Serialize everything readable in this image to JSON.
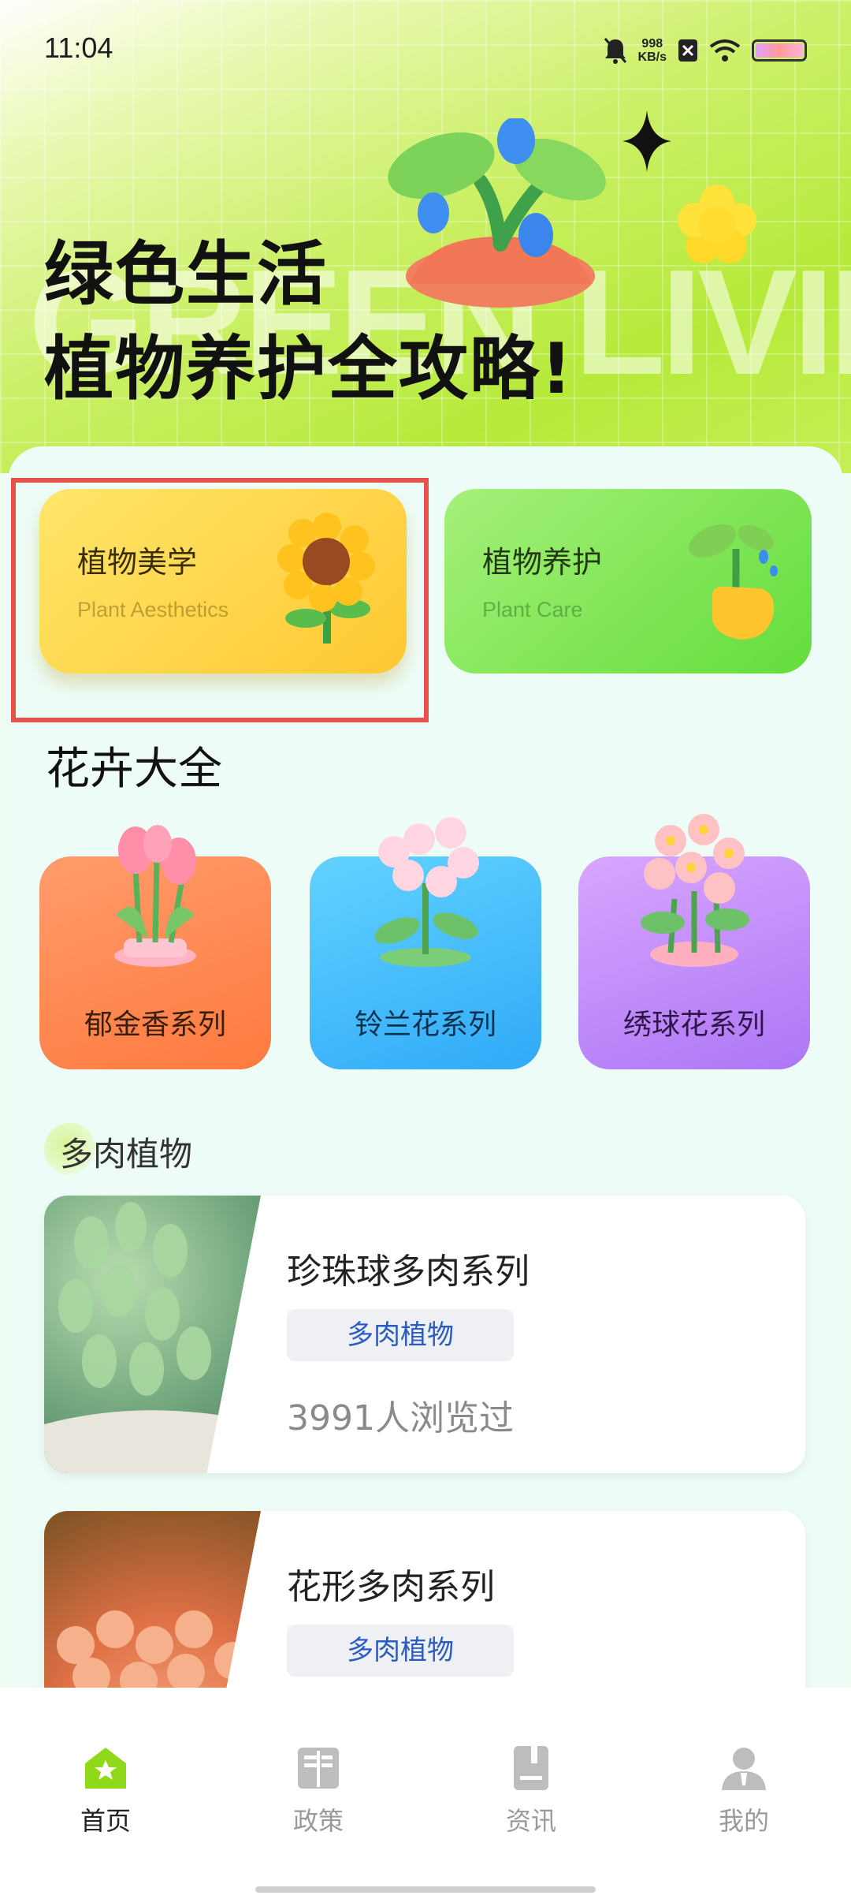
{
  "status_bar": {
    "time": "11:04",
    "net_speed_value": "998",
    "net_speed_unit": "KB/s",
    "icons": [
      "bell-muted-icon",
      "sim-x-icon",
      "wifi-icon",
      "battery-icon"
    ]
  },
  "hero": {
    "title_line1": "绿色生活",
    "title_line2": "植物养护全攻略!",
    "watermark": "GREEN LIVING"
  },
  "feature_cards": [
    {
      "title": "植物美学",
      "subtitle": "Plant Aesthetics",
      "icon": "sunflower-icon",
      "color": "#ffd43f"
    },
    {
      "title": "植物养护",
      "subtitle": "Plant Care",
      "icon": "hand-sprout-icon",
      "color": "#7ee457"
    }
  ],
  "flowers_section": {
    "title": "花卉大全",
    "categories": [
      {
        "label": "郁金香系列",
        "icon": "tulip-icon",
        "color": "#ff8a50"
      },
      {
        "label": "铃兰花系列",
        "icon": "lily-of-valley-icon",
        "color": "#45bdfb"
      },
      {
        "label": "绣球花系列",
        "icon": "hydrangea-icon",
        "color": "#c08cf9"
      }
    ]
  },
  "succulents_section": {
    "title": "多肉植物",
    "items": [
      {
        "name": "珍珠球多肉系列",
        "tag": "多肉植物",
        "views": "3991人浏览过"
      },
      {
        "name": "花形多肉系列",
        "tag": "多肉植物"
      }
    ]
  },
  "bottom_nav": {
    "items": [
      {
        "label": "首页",
        "icon": "home-icon",
        "active": true
      },
      {
        "label": "政策",
        "icon": "book-icon",
        "active": false
      },
      {
        "label": "资讯",
        "icon": "document-icon",
        "active": false
      },
      {
        "label": "我的",
        "icon": "user-icon",
        "active": false
      }
    ]
  },
  "colors": {
    "accent_green": "#8fd81a",
    "highlight_border": "#e5534b",
    "tag_text": "#2a5cc4"
  }
}
